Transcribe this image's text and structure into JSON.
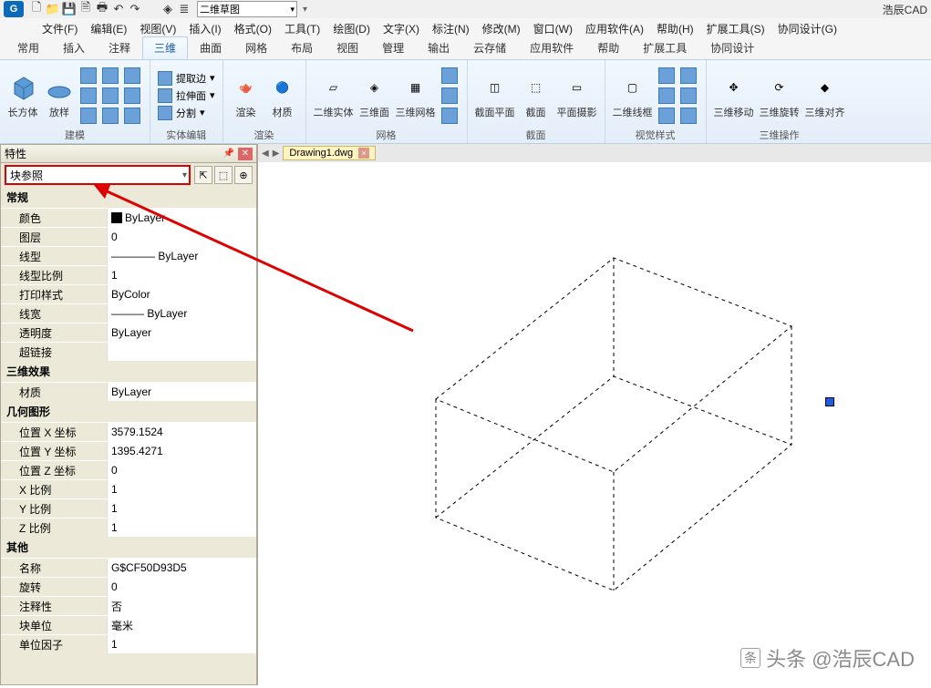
{
  "app": {
    "brand": "浩辰CAD",
    "logo": "G"
  },
  "qat_layer_selected": "二维草图",
  "menus": [
    "文件(F)",
    "编辑(E)",
    "视图(V)",
    "插入(I)",
    "格式(O)",
    "工具(T)",
    "绘图(D)",
    "文字(X)",
    "标注(N)",
    "修改(M)",
    "窗口(W)",
    "应用软件(A)",
    "帮助(H)",
    "扩展工具(S)",
    "协同设计(G)"
  ],
  "tabs": [
    "常用",
    "插入",
    "注释",
    "三维",
    "曲面",
    "网格",
    "布局",
    "视图",
    "管理",
    "输出",
    "云存储",
    "应用软件",
    "帮助",
    "扩展工具",
    "协同设计"
  ],
  "active_tab": "三维",
  "ribbon": {
    "panel1": {
      "label": "建模",
      "btn1": "长方体",
      "btn2": "放样"
    },
    "panel2": {
      "label": "实体编辑",
      "t1": "提取边",
      "t2": "拉伸面",
      "t3": "分割",
      "dd": "▾"
    },
    "panel3": {
      "label": "渲染",
      "b1": "渲染",
      "b2": "材质"
    },
    "panel4": {
      "label": "网格",
      "b1": "二维实体",
      "b2": "三维面",
      "b3": "三维网格"
    },
    "panel5": {
      "label": "截面",
      "b1": "截面平面",
      "b2": "截面",
      "b3": "平面摄影"
    },
    "panel6": {
      "label": "视觉样式",
      "b1": "二维线框"
    },
    "panel7": {
      "label": "三维操作",
      "b1": "三维移动",
      "b2": "三维旋转",
      "b3": "三维对齐"
    }
  },
  "docTab": "Drawing1.dwg",
  "props": {
    "title": "特性",
    "selector": "块参照",
    "sections": [
      {
        "name": "常规",
        "rows": [
          {
            "k": "颜色",
            "v": "ByLayer",
            "swatch": true
          },
          {
            "k": "图层",
            "v": "0"
          },
          {
            "k": "线型",
            "v": "———— ByLayer"
          },
          {
            "k": "线型比例",
            "v": "1"
          },
          {
            "k": "打印样式",
            "v": "ByColor"
          },
          {
            "k": "线宽",
            "v": "——— ByLayer"
          },
          {
            "k": "透明度",
            "v": "ByLayer"
          },
          {
            "k": "超链接",
            "v": ""
          }
        ]
      },
      {
        "name": "三维效果",
        "rows": [
          {
            "k": "材质",
            "v": "ByLayer"
          }
        ]
      },
      {
        "name": "几何图形",
        "rows": [
          {
            "k": "位置 X 坐标",
            "v": "3579.1524"
          },
          {
            "k": "位置 Y 坐标",
            "v": "1395.4271"
          },
          {
            "k": "位置 Z 坐标",
            "v": "0"
          },
          {
            "k": "X 比例",
            "v": "1"
          },
          {
            "k": "Y 比例",
            "v": "1"
          },
          {
            "k": "Z 比例",
            "v": "1"
          }
        ]
      },
      {
        "name": "其他",
        "rows": [
          {
            "k": "名称",
            "v": "G$CF50D93D5"
          },
          {
            "k": "旋转",
            "v": "0"
          },
          {
            "k": "注释性",
            "v": "否"
          },
          {
            "k": "块单位",
            "v": "毫米"
          },
          {
            "k": "单位因子",
            "v": "1"
          }
        ]
      }
    ]
  },
  "watermark": "头条 @浩辰CAD"
}
